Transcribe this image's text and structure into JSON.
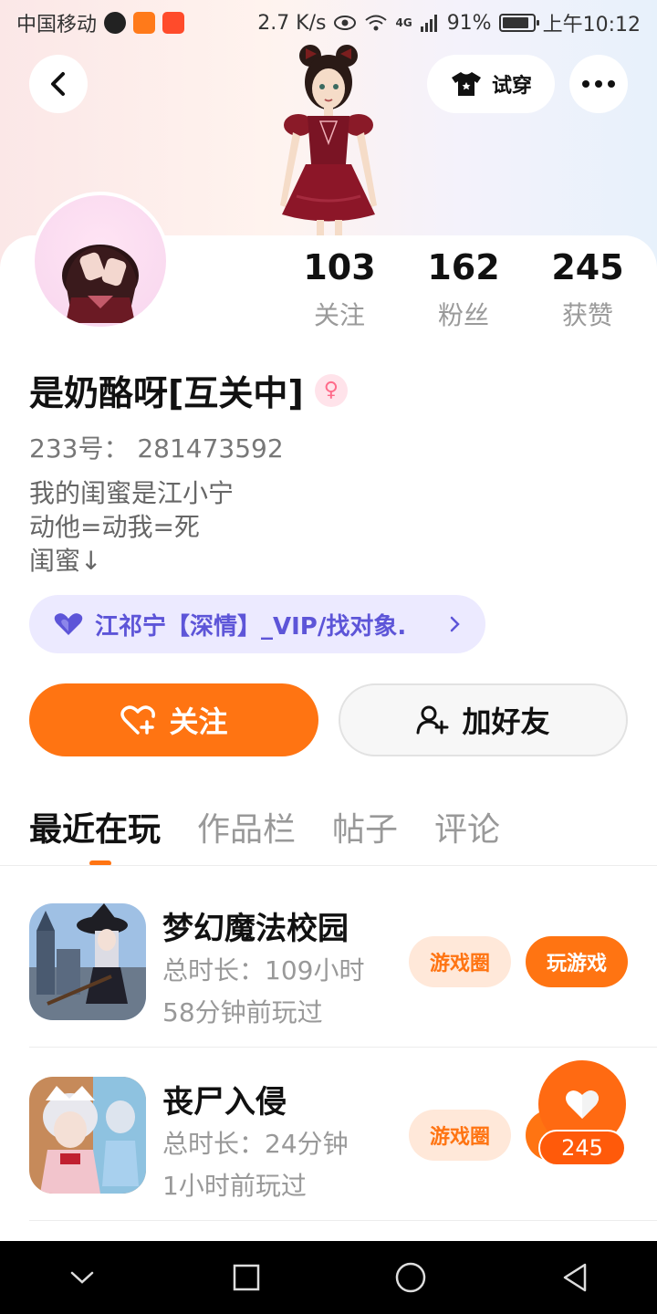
{
  "status_bar": {
    "carrier": "中国移动",
    "speed": "2.7 K/s",
    "network": "4G",
    "battery": "91%",
    "time": "上午10:12"
  },
  "header": {
    "tryon_label": "试穿"
  },
  "profile": {
    "stats": [
      {
        "value": "103",
        "label": "关注"
      },
      {
        "value": "162",
        "label": "粉丝"
      },
      {
        "value": "245",
        "label": "获赞"
      }
    ],
    "name": "是奶酪呀[互关中]",
    "gender_symbol": "♀",
    "id_text": "233号： 281473592",
    "bio_lines": [
      "我的闺蜜是江小宁",
      "动他=动我=死",
      "闺蜜↓"
    ],
    "relation": "江祁宁【深情】_VIP/找对象."
  },
  "actions": {
    "follow_label": "关注",
    "add_friend_label": "加好友"
  },
  "tabs": [
    "最近在玩",
    "作品栏",
    "帖子",
    "评论"
  ],
  "games": [
    {
      "title": "梦幻魔法校园",
      "duration": "总时长：109小时",
      "last_played": "58分钟前玩过",
      "circle_label": "游戏圈",
      "play_label": "玩游戏"
    },
    {
      "title": "丧尸入侵",
      "duration": "总时长：24分钟",
      "last_played": "1小时前玩过",
      "circle_label": "游戏圈"
    }
  ],
  "float_like": {
    "count": "245"
  }
}
